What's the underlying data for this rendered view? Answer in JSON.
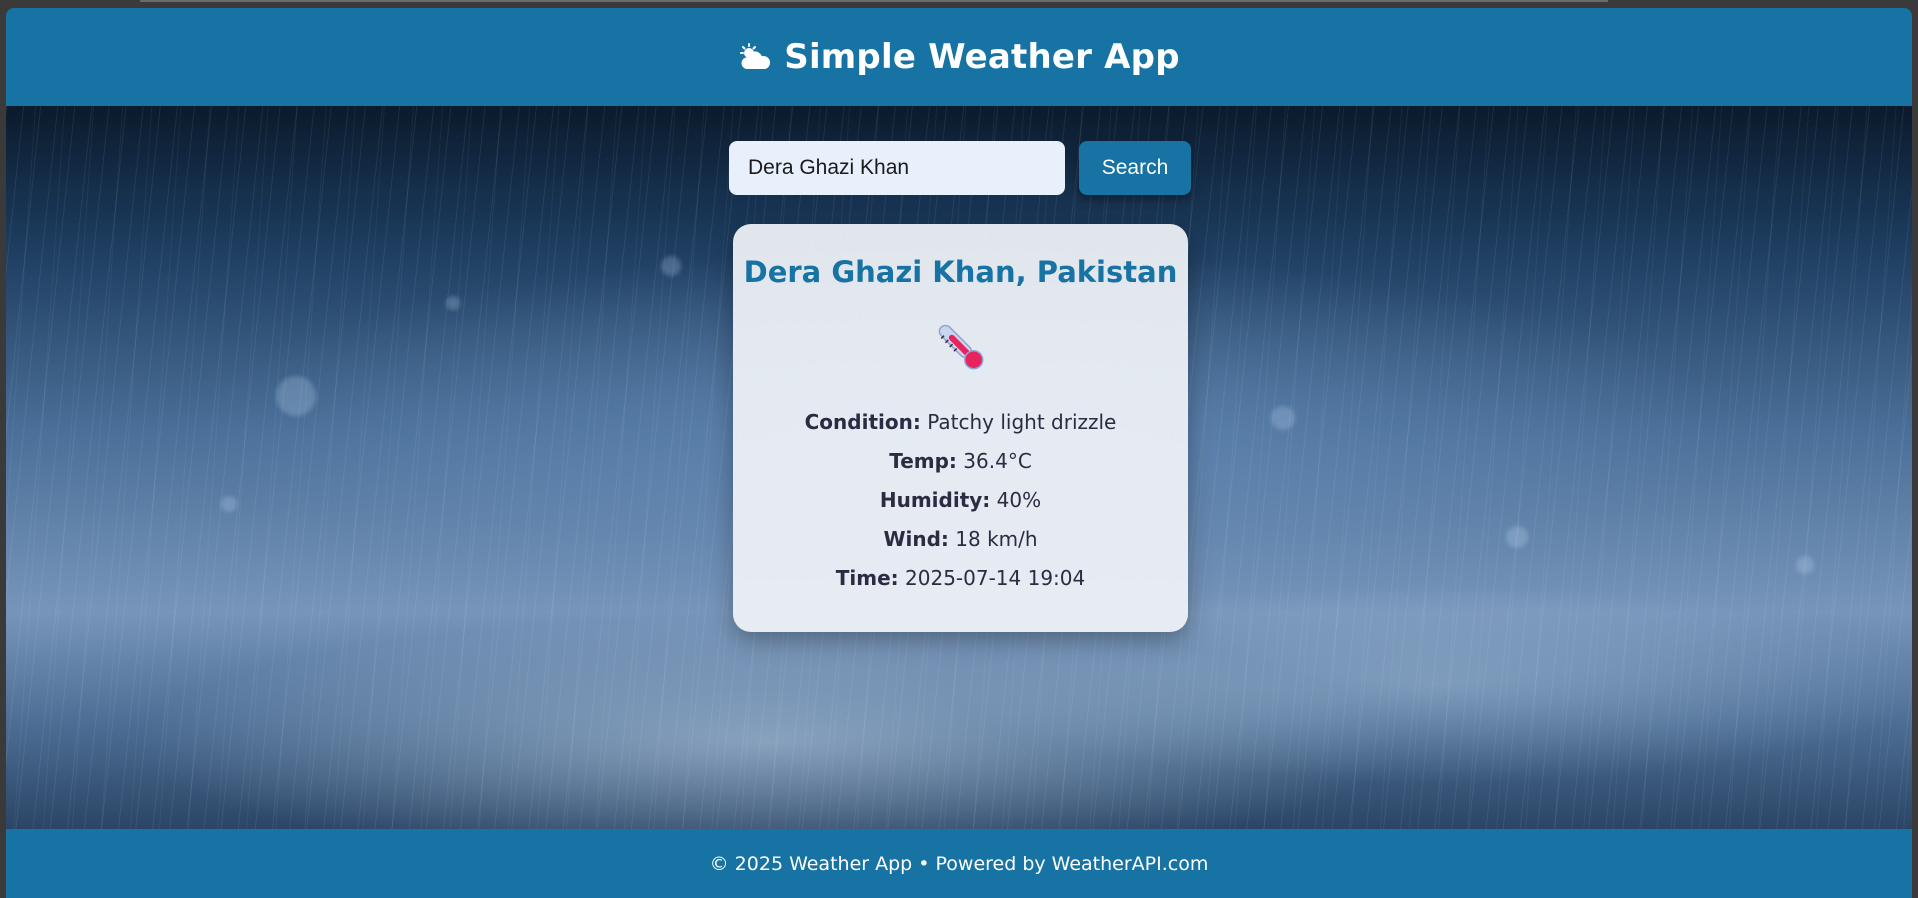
{
  "header": {
    "title": "Simple Weather App",
    "icon": "sun-behind-cloud-icon"
  },
  "search": {
    "value": "Dera Ghazi Khan",
    "button_label": "Search"
  },
  "weather": {
    "location": "Dera Ghazi Khan, Pakistan",
    "icon": "thermometer-icon",
    "rows": [
      {
        "label": "Condition:",
        "value": "Patchy light drizzle"
      },
      {
        "label": "Temp:",
        "value": "36.4°C"
      },
      {
        "label": "Humidity:",
        "value": "40%"
      },
      {
        "label": "Wind:",
        "value": "18 km/h"
      },
      {
        "label": "Time:",
        "value": "2025-07-14 19:04"
      }
    ]
  },
  "footer": {
    "text": "© 2025 Weather App • Powered by WeatherAPI.com"
  },
  "colors": {
    "primary": "#1673a3",
    "card_bg": "#eef1f6",
    "input_bg": "#e8f0fc"
  }
}
